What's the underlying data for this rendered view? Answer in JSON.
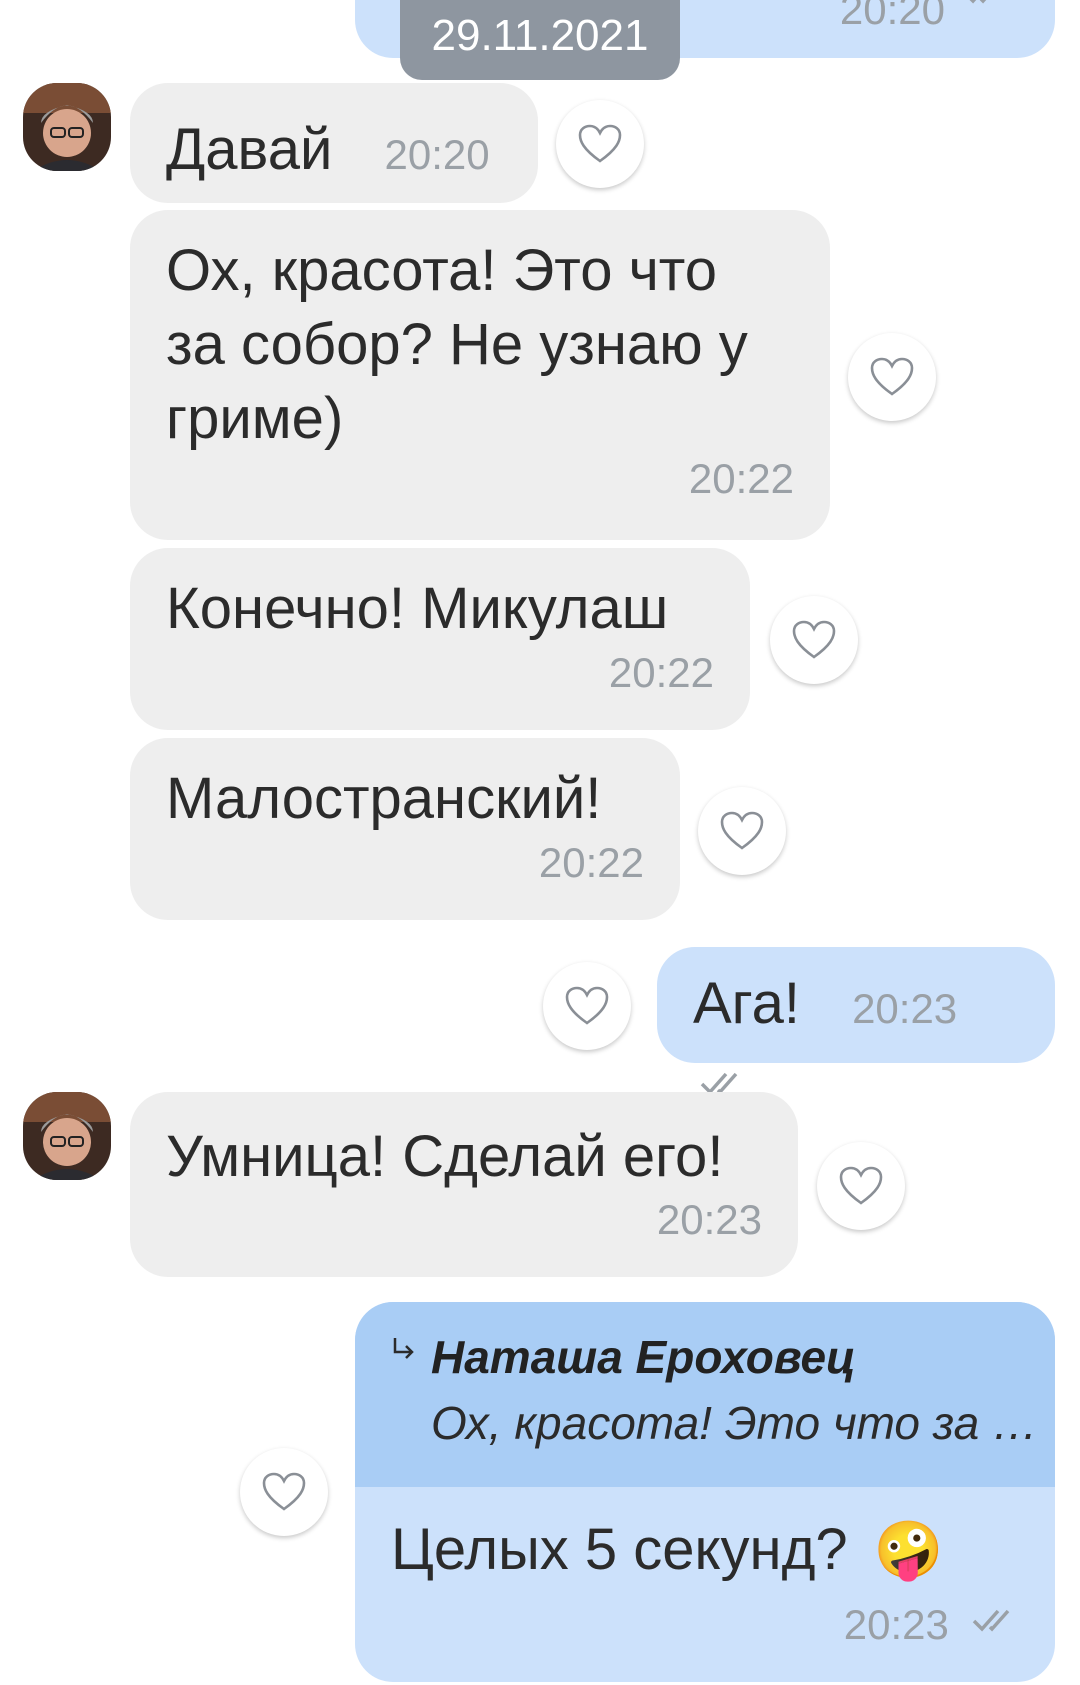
{
  "date_badge": "29.11.2021",
  "top_partial": {
    "time": "20:20"
  },
  "contact_name": "Наташа Ероховец",
  "messages": [
    {
      "text": "Давай",
      "time": "20:20"
    },
    {
      "text_lines": [
        "Ох, красота! Это что",
        "за собор? Не узнаю у",
        "гриме)"
      ],
      "time": "20:22"
    },
    {
      "text": "Конечно! Микулаш",
      "time": "20:22"
    },
    {
      "text": "Малостранский!",
      "time": "20:22"
    },
    {
      "text": "Ага!",
      "time": "20:23"
    },
    {
      "text": "Умница! Сделай его!",
      "time": "20:23"
    },
    {
      "reply_author": "Наташа Ероховец",
      "reply_quote": "Ох, красота! Это что за …",
      "text": "Целых 5 секунд?",
      "emoji": "🤪",
      "time": "20:23"
    }
  ],
  "colors": {
    "incoming_bubble": "#eeeeee",
    "outgoing_bubble": "#cce1fb",
    "reply_header": "#a9cdf5",
    "date_badge": "#8e96a0"
  },
  "icons": [
    "heart-icon",
    "double-check-icon",
    "reply-arrow-icon"
  ]
}
